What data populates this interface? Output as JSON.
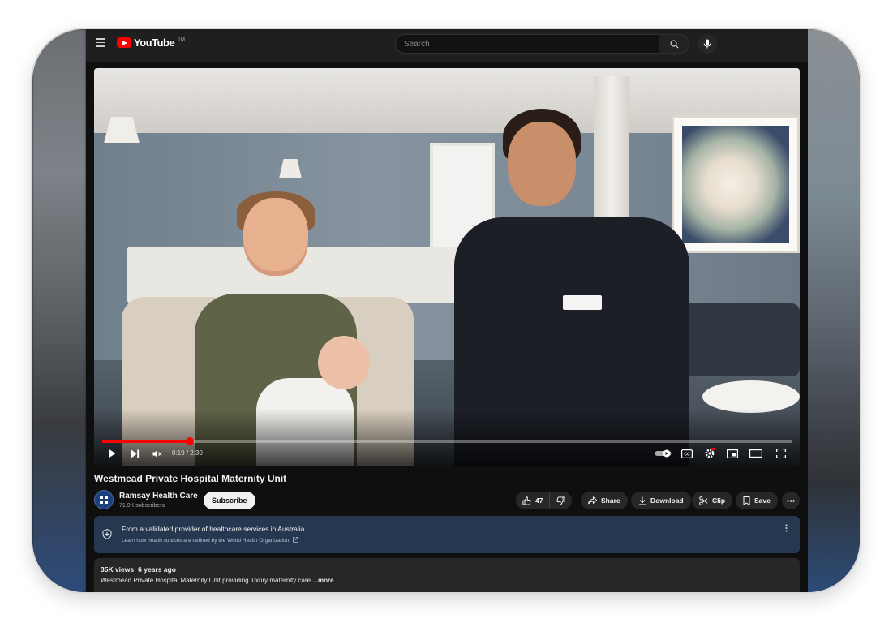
{
  "header": {
    "logo_text": "YouTube",
    "logo_tm": "TM",
    "search_placeholder": "Search"
  },
  "player": {
    "time_display": "0:19 / 2:30",
    "progress_fraction": 0.127
  },
  "video": {
    "title": "Westmead Private Hospital Maternity Unit"
  },
  "channel": {
    "name": "Ramsay Health Care",
    "subscribers": "71.9K subscribers",
    "subscribe_label": "Subscribe"
  },
  "actions": {
    "like_count": "47",
    "share_label": "Share",
    "download_label": "Download",
    "clip_label": "Clip",
    "save_label": "Save"
  },
  "info_panel": {
    "title": "From a validated provider of healthcare services in Australia",
    "subtitle": "Learn how health sources are defined by the World Health Organization"
  },
  "description": {
    "views": "35K views",
    "age": "6 years ago",
    "text": "Westmead Private Hospital Maternity Unit providing luxury maternity care",
    "more": " ...more"
  }
}
